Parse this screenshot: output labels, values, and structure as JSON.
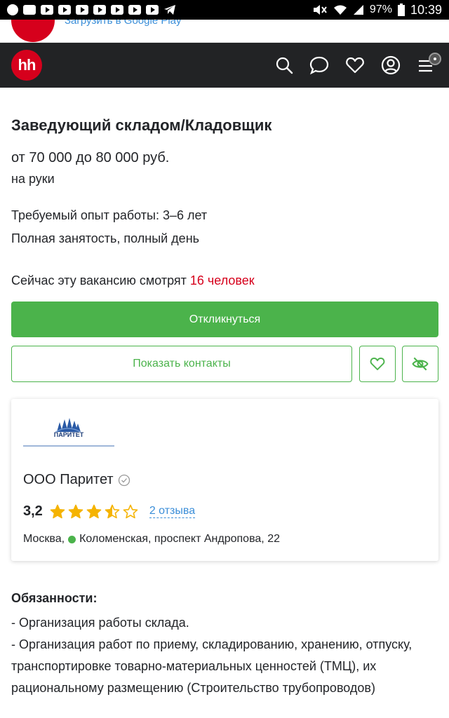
{
  "status_bar": {
    "battery": "97%",
    "time": "10:39",
    "icons": [
      "reddit-icon",
      "beaver-icon",
      "youtube-icon",
      "youtube-icon",
      "youtube-icon",
      "youtube-icon",
      "youtube-icon",
      "youtube-icon",
      "youtube-icon",
      "telegram-icon"
    ]
  },
  "banner": {
    "link_text": "Загрузить в Google Play"
  },
  "header": {
    "logo": "hh",
    "icons": [
      "search-icon",
      "chat-icon",
      "heart-icon",
      "profile-icon",
      "menu-icon"
    ]
  },
  "vacancy": {
    "title": "Заведующий складом/Кладовщик",
    "salary": "от 70 000 до 80 000 руб.",
    "salary_note": "на руки",
    "experience": "Требуемый опыт работы: 3–6 лет",
    "employment": "Полная занятость, полный день",
    "watching_prefix": "Сейчас эту вакансию смотрят ",
    "watching_count": "16 человек"
  },
  "actions": {
    "apply": "Откликнуться",
    "show_contacts": "Показать контакты"
  },
  "company": {
    "logo_text": "ПАРИТЕТ",
    "name": "ООО Паритет",
    "rating": "3,2",
    "rating_value": 3.5,
    "rating_max": 5,
    "reviews": "2 отзыва",
    "city": "Москва,",
    "metro": "Коломенская, проспект Андропова, 22",
    "accent": "#4bb34b"
  },
  "description": {
    "duties_title": "Обязанности:",
    "duties_lines": [
      "- Организация работы склада.",
      "- Организация работ по приему, складированию, хранению, отпуску, транспортировке товарно-материальных ценностей (ТМЦ), их рациональному размещению (Строительство трубопроводов)"
    ]
  },
  "colors": {
    "brand_red": "#d6001c",
    "green": "#4bb34b",
    "link_blue": "#3b8ed8",
    "header_bg": "#222325"
  }
}
